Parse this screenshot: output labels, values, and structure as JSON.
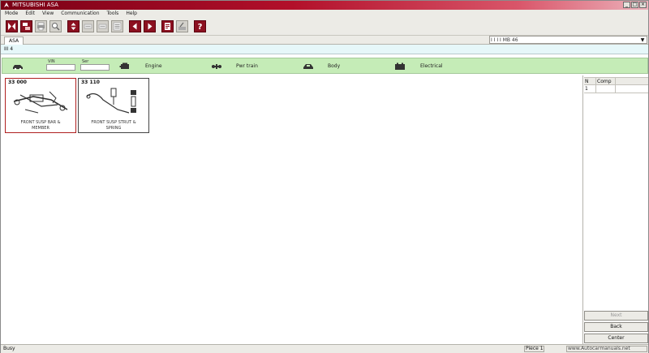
{
  "window": {
    "title": "MITSUBISHI ASA",
    "buttons": [
      "_",
      "□",
      "×"
    ]
  },
  "menu": {
    "items": [
      "Mode",
      "Edit",
      "View",
      "Communication",
      "Tools",
      "Help"
    ]
  },
  "toolbar": {
    "buttons": [
      {
        "name": "exit-button",
        "icon": "exit-icon",
        "style": "red"
      },
      {
        "name": "select-model-button",
        "icon": "model-icon",
        "style": "red"
      },
      {
        "name": "print-button",
        "icon": "print-icon",
        "style": "gray"
      },
      {
        "name": "zoom-button",
        "icon": "zoom-icon",
        "style": "gray"
      },
      {
        "name": "updown-button",
        "icon": "updown-icon",
        "style": "red"
      },
      {
        "name": "find-button",
        "icon": "find-icon",
        "style": "gray"
      },
      {
        "name": "find-next-button",
        "icon": "find-next-icon",
        "style": "gray"
      },
      {
        "name": "list-button",
        "icon": "list-icon",
        "style": "gray"
      },
      {
        "name": "prev-button",
        "icon": "prev-icon",
        "style": "red"
      },
      {
        "name": "next-button",
        "icon": "next-icon",
        "style": "red"
      },
      {
        "name": "notes-button",
        "icon": "notes-icon",
        "style": "red"
      },
      {
        "name": "settings-button",
        "icon": "settings-icon",
        "style": "gray"
      },
      {
        "name": "help-button",
        "icon": "help-icon",
        "style": "red"
      }
    ]
  },
  "tabs": {
    "active": "ASA",
    "info": "I I I I    MB 46",
    "dropdown_arrow": "▼"
  },
  "path": {
    "text": "III 4"
  },
  "filters": {
    "vin_caption": "VIN",
    "ser_caption": "Ser",
    "groups": [
      {
        "label": "Engine"
      },
      {
        "label": "Pwr train"
      },
      {
        "label": "Body"
      },
      {
        "label": "Electrical"
      }
    ]
  },
  "cards": [
    {
      "code": "33 000",
      "title_line1": "FRONT SUSP BAR &",
      "title_line2": "MEMBER",
      "selected": true
    },
    {
      "code": "33 110",
      "title_line1": "FRONT SUSP STRUT &",
      "title_line2": "SPRING",
      "selected": false
    }
  ],
  "right_panel": {
    "columns": [
      "N",
      "Comp",
      ""
    ],
    "rows": [
      [
        "1",
        "",
        ""
      ]
    ],
    "buttons": [
      {
        "label": "Next",
        "disabled": true
      },
      {
        "label": "Back",
        "disabled": false
      },
      {
        "label": "Center",
        "disabled": false
      }
    ]
  },
  "status": {
    "text": "Busy",
    "panel1": "Piece 1",
    "panel2": "www.Autocarmanuals.net"
  },
  "colors": {
    "accent": "#8c1020",
    "filter_bar": "#c5ecb7",
    "path_bar": "#e6f7f9"
  }
}
